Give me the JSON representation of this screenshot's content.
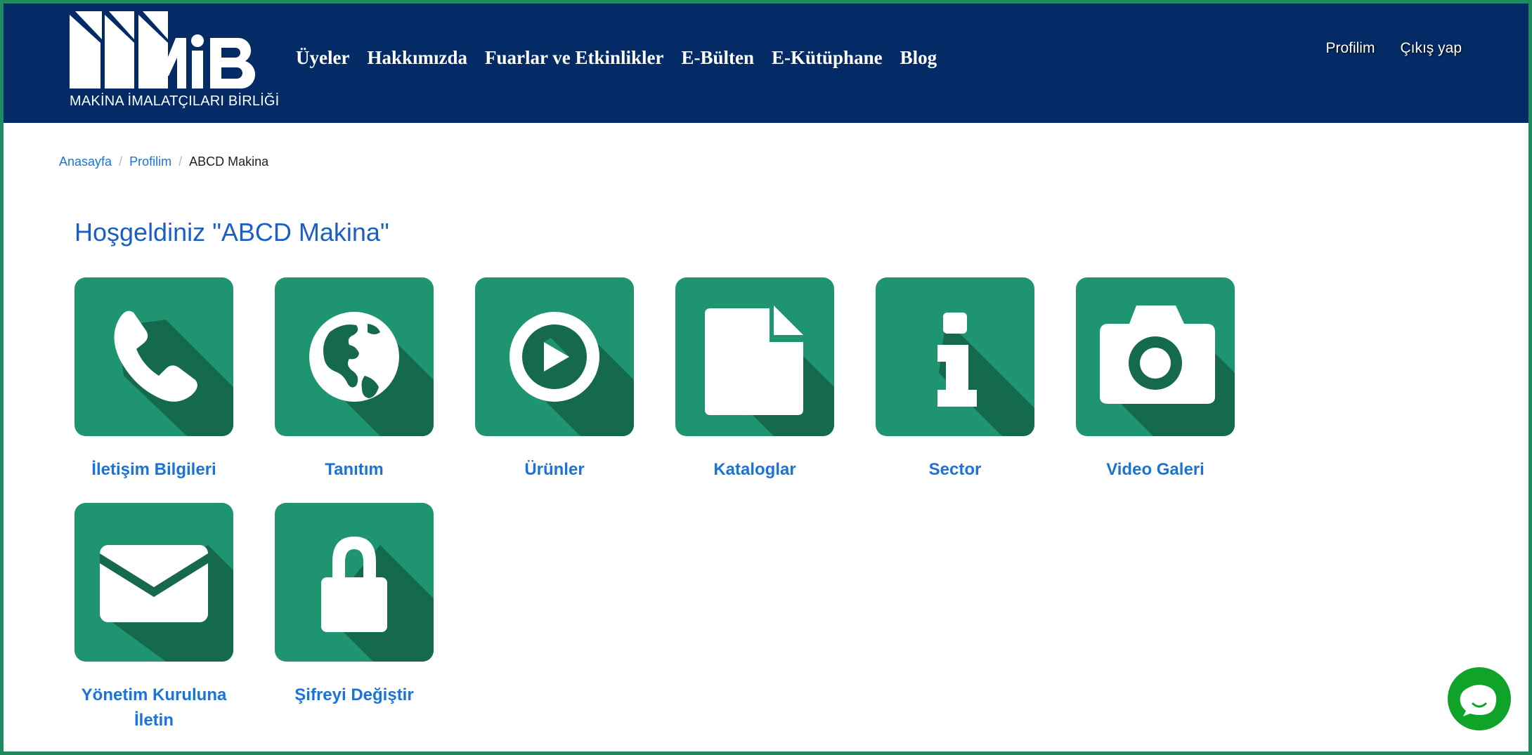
{
  "header": {
    "logo_letters": "MiB",
    "logo_text": "MAKİNA İMALATÇILARI BİRLİĞİ",
    "nav": [
      "Üyeler",
      "Hakkımızda",
      "Fuarlar ve Etkinlikler",
      "E-Bülten",
      "E-Kütüphane",
      "Blog"
    ],
    "user_links": {
      "profile": "Profilim",
      "logout": "Çıkış yap"
    }
  },
  "breadcrumb": {
    "home": "Anasayfa",
    "profile": "Profilim",
    "current": "ABCD Makina"
  },
  "welcome": "Hoşgeldiniz \"ABCD Makina\"",
  "tiles": [
    {
      "label": "İletişim Bilgileri",
      "icon": "phone-icon"
    },
    {
      "label": "Tanıtım",
      "icon": "globe-icon"
    },
    {
      "label": "Ürünler",
      "icon": "play-icon"
    },
    {
      "label": "Kataloglar",
      "icon": "document-icon"
    },
    {
      "label": "Sector",
      "icon": "info-icon"
    },
    {
      "label": "Video Galeri",
      "icon": "camera-icon"
    },
    {
      "label": "Yönetim Kuruluna İletin",
      "icon": "envelope-icon"
    },
    {
      "label": "Şifreyi Değiştir",
      "icon": "lock-icon"
    }
  ],
  "colors": {
    "header_bg": "#042b66",
    "tile_bg": "#1f9470",
    "tile_shadow": "#156a4d",
    "link": "#1a73d9",
    "chat": "#0fa32a"
  }
}
